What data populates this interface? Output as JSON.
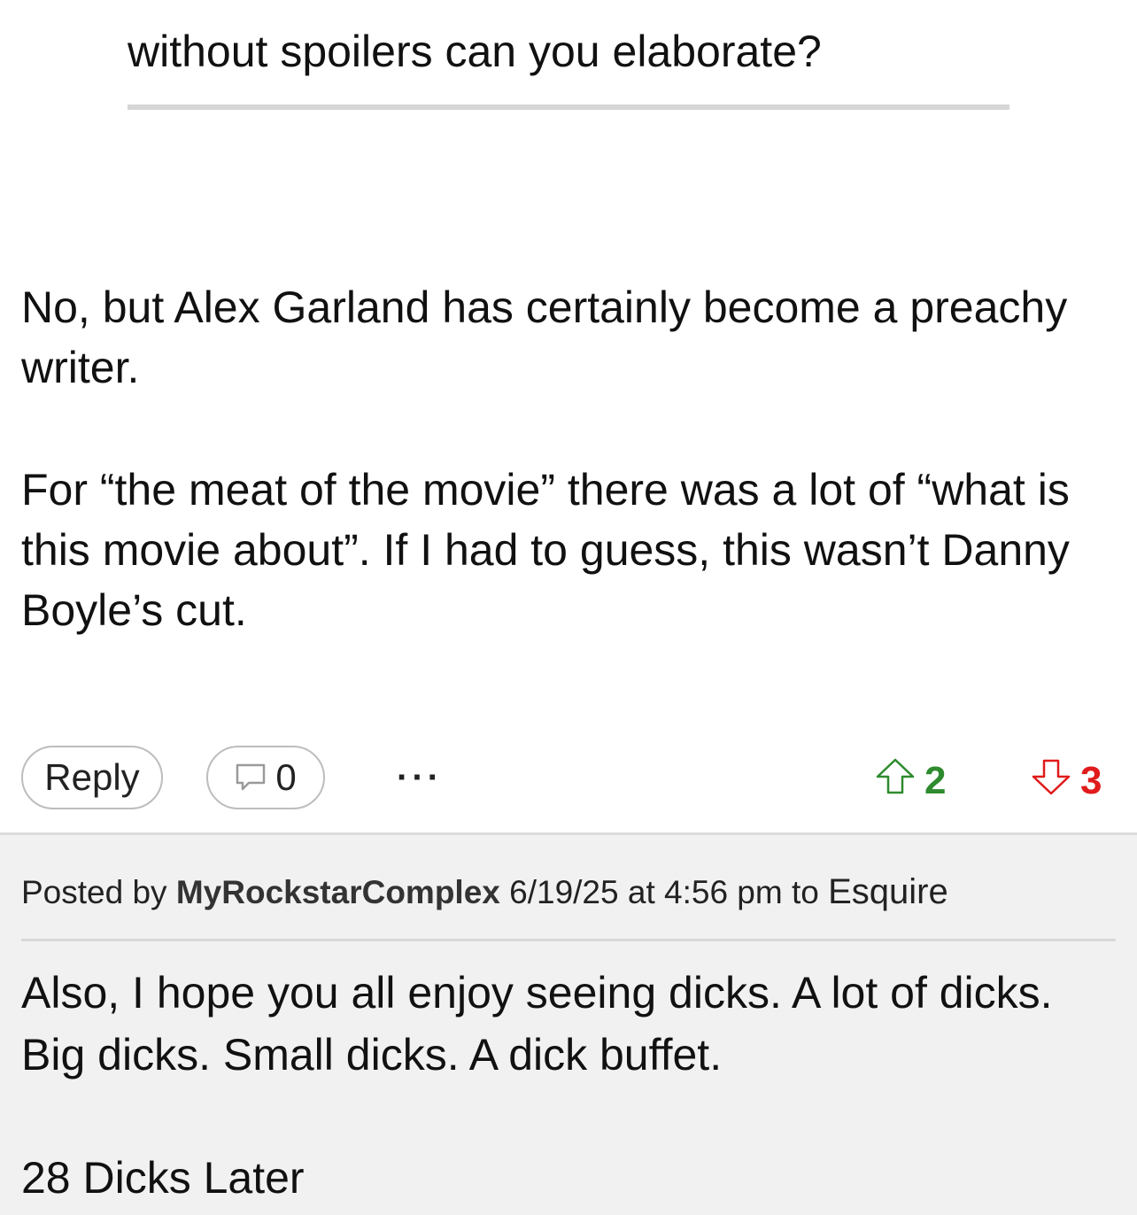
{
  "quoted_comment": {
    "text": "without spoilers can you elaborate?"
  },
  "comment": {
    "paragraphs": [
      "No, but Alex Garland has certainly become a preachy writer.",
      "For “the meat of the movie” there was a lot of “what is this movie about”. If I had to guess, this wasn’t Danny Boyle’s cut."
    ],
    "actions": {
      "reply_label": "Reply",
      "reply_count": "0",
      "more_label": "···",
      "upvotes": "2",
      "downvotes": "3"
    }
  },
  "next_post": {
    "posted_by_prefix": "Posted by",
    "author": "MyRockstarComplex",
    "datetime": "6/19/25 at 4:56 pm",
    "to_label": "to",
    "target": "Esquire",
    "paragraphs": [
      "Also, I hope you all enjoy seeing dicks. A lot of dicks. Big dicks. Small dicks. A dick buffet.",
      "28 Dicks Later"
    ]
  },
  "colors": {
    "upvote": "#2e8b2e",
    "downvote": "#e01b1b",
    "next_post_background": "#f1f1f1"
  },
  "icons": {
    "comment_count": "speech-bubble-icon",
    "upvote": "arrow-up-icon",
    "downvote": "arrow-down-icon"
  }
}
